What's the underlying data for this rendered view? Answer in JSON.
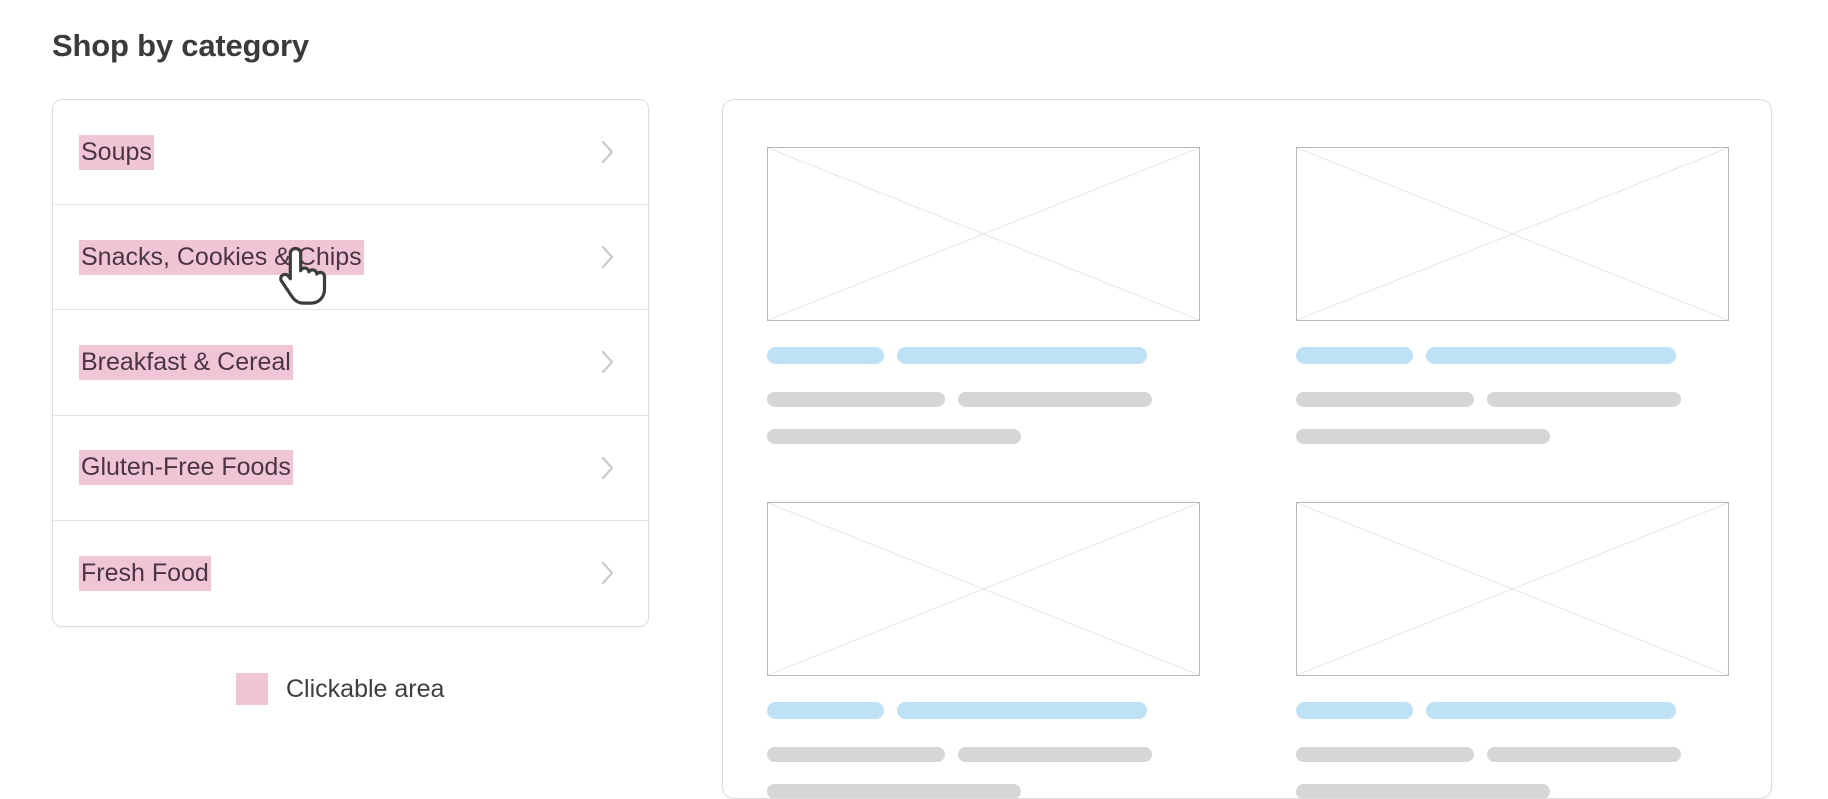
{
  "page": {
    "title": "Shop by category"
  },
  "categories": {
    "items": [
      {
        "label": "Soups",
        "chevron_icon": "chevron-right-icon"
      },
      {
        "label": "Snacks, Cookies & Chips",
        "chevron_icon": "chevron-right-icon"
      },
      {
        "label": "Breakfast & Cereal",
        "chevron_icon": "chevron-right-icon"
      },
      {
        "label": "Gluten-Free Foods",
        "chevron_icon": "chevron-right-icon"
      },
      {
        "label": "Fresh Food",
        "chevron_icon": "chevron-right-icon"
      }
    ]
  },
  "legend": {
    "swatch_color": "#f0c6d7",
    "label": "Clickable area"
  },
  "cursor": {
    "icon": "pointer-hand-cursor",
    "hovered_item": "Snacks, Cookies & Chips"
  },
  "colors": {
    "highlight_pink": "#f0c6d7",
    "placeholder_blue": "#bfe1f5",
    "placeholder_gray": "#d6d6d6",
    "border_gray": "#dcdcdc",
    "divider_gray": "#e4e4e4",
    "chevron_gray": "#c9c9c9",
    "title_text": "#3b3b3b",
    "label_text": "#4a3540"
  },
  "content_panel": {
    "placeholder_cards": [
      {
        "image_icon": "image-placeholder-crossbox"
      },
      {
        "image_icon": "image-placeholder-crossbox"
      },
      {
        "image_icon": "image-placeholder-crossbox"
      },
      {
        "image_icon": "image-placeholder-crossbox"
      }
    ]
  }
}
